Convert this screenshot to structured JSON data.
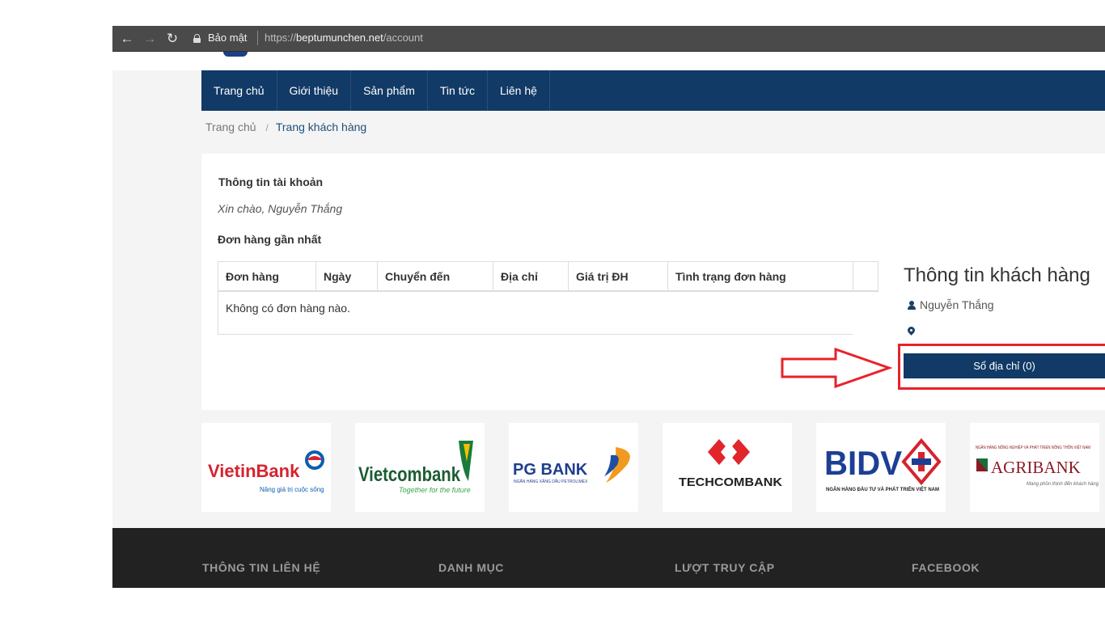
{
  "browser": {
    "secure_label": "Bảo mật",
    "url_scheme": "https://",
    "url_host": "beptumunchen.net",
    "url_path": "/account"
  },
  "nav": {
    "items": [
      "Trang chủ",
      "Giới thiệu",
      "Sản phẩm",
      "Tin tức",
      "Liên hệ"
    ]
  },
  "breadcrumb": {
    "home": "Trang chủ",
    "separator": "/",
    "current": "Trang khách hàng"
  },
  "account": {
    "title": "Thông tin tài khoản",
    "greeting": "Xin chào, Nguyễn Thắng",
    "orders_title": "Đơn hàng gần nhất",
    "table_headers": [
      "Đơn hàng",
      "Ngày",
      "Chuyển đến",
      "Địa chỉ",
      "Giá trị ĐH",
      "Tình trạng đơn hàng"
    ],
    "empty_message": "Không có đơn hàng nào."
  },
  "customer": {
    "title": "Thông tin khách hàng",
    "name": "Nguyễn Thắng",
    "address_book_button": "Sổ địa chỉ (0)"
  },
  "banks": [
    {
      "name": "VietinBank",
      "tagline": "Nâng giá trị cuộc sống"
    },
    {
      "name": "Vietcombank",
      "tagline": "Together for the future"
    },
    {
      "name": "PG BANK",
      "tagline": "NGÂN HÀNG XĂNG DẦU PETROLIMEX"
    },
    {
      "name": "TECHCOMBANK",
      "tagline": ""
    },
    {
      "name": "BIDV",
      "tagline": "NGÂN HÀNG ĐẦU TƯ VÀ PHÁT TRIỂN VIỆT NAM"
    },
    {
      "name": "AGRIBANK",
      "tagline": "Mang phồn thịnh đến khách hàng",
      "header": "NGÂN HÀNG NÔNG NGHIỆP VÀ PHÁT TRIỂN NÔNG THÔN VIỆT NAM"
    }
  ],
  "footer": {
    "columns": [
      "THÔNG TIN LIÊN HỆ",
      "DANH MỤC",
      "LƯỢT TRUY CẬP",
      "FACEBOOK"
    ]
  },
  "colors": {
    "nav_bg": "#113a66",
    "button_bg": "#113a66",
    "annotation_red": "#e8222b",
    "footer_bg": "#222222"
  }
}
